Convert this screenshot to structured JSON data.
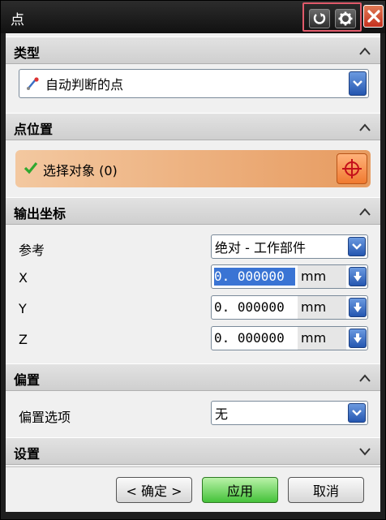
{
  "window": {
    "title": "点"
  },
  "sections": {
    "type": {
      "header": "类型",
      "combo_value": "自动判断的点"
    },
    "point_location": {
      "header": "点位置",
      "select_label": "选择对象 (0)"
    },
    "output_coords": {
      "header": "输出坐标",
      "reference_label": "参考",
      "reference_value": "绝对 - 工作部件",
      "fields": [
        {
          "label": "X",
          "value": "0. 000000",
          "unit": "mm"
        },
        {
          "label": "Y",
          "value": "0. 000000",
          "unit": "mm"
        },
        {
          "label": "Z",
          "value": "0. 000000",
          "unit": "mm"
        }
      ]
    },
    "offset": {
      "header": "偏置",
      "option_label": "偏置选项",
      "option_value": "无"
    },
    "settings": {
      "header": "设置"
    }
  },
  "buttons": {
    "ok": "< 确定 >",
    "apply": "应用",
    "cancel": "取消"
  },
  "colors": {
    "accent_orange": "#e79b60",
    "apply_green": "#45c23a",
    "combo_blue": "#2456b0",
    "highlight_red": "#e05a6a"
  },
  "icons": {
    "title_reset": "reset-icon",
    "title_settings": "gear-icon",
    "title_close": "close-icon",
    "type_combo": "inferred-point-icon",
    "select_check": "check-icon",
    "point_dialog": "crosshair-icon"
  }
}
